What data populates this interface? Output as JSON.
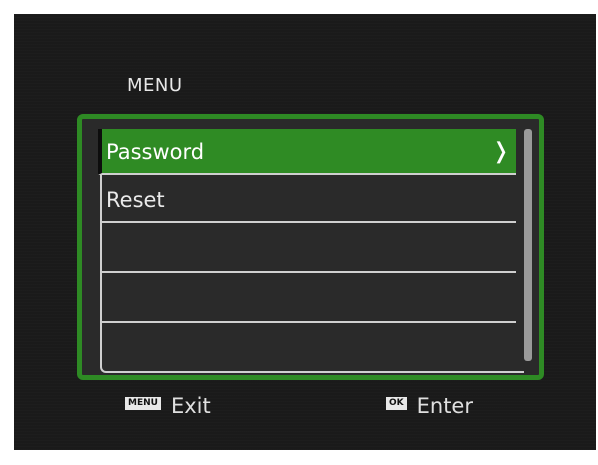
{
  "menu": {
    "title": "MENU",
    "items": [
      {
        "label": "Password",
        "selected": true,
        "chevron": "❭"
      },
      {
        "label": "Reset",
        "selected": false
      },
      {
        "label": "",
        "selected": false
      },
      {
        "label": "",
        "selected": false
      }
    ]
  },
  "footer": {
    "exit_key": "MENU",
    "exit_label": "Exit",
    "enter_key": "OK",
    "enter_label": "Enter"
  },
  "colors": {
    "accent": "#2f8b24",
    "background": "#1a1a1a"
  }
}
